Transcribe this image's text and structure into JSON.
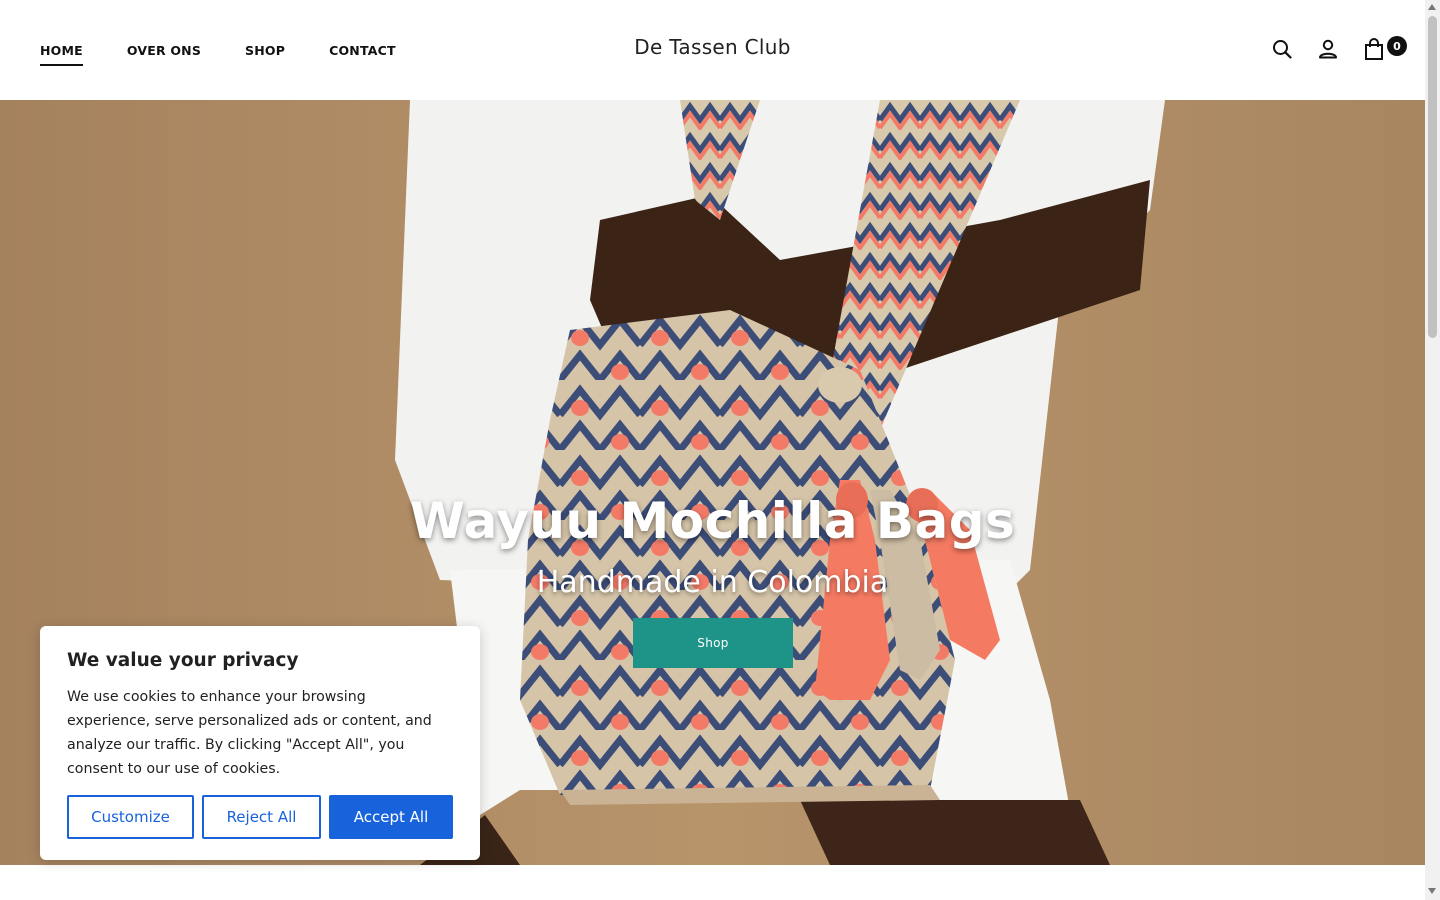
{
  "header": {
    "nav": [
      {
        "label": "HOME",
        "active": true
      },
      {
        "label": "OVER ONS"
      },
      {
        "label": "SHOP"
      },
      {
        "label": "CONTACT"
      }
    ],
    "logo": "De Tassen Club",
    "icons": [
      "search-icon",
      "account-icon",
      "cart-icon"
    ],
    "cart_count": "0"
  },
  "hero": {
    "title": "Wayuu Mochilla Bags",
    "subtitle": "Handmade in Colombia",
    "button_label": "Shop",
    "button_color": "#1e9488"
  },
  "cookie_banner": {
    "title": "We value your privacy",
    "text": "We use cookies to enhance your browsing experience, serve personalized ads or content, and analyze our traffic. By clicking \"Accept All\", you consent to our use of cookies.",
    "customize_label": "Customize",
    "reject_label": "Reject All",
    "accept_label": "Accept All",
    "accent_color": "#1863dc"
  }
}
